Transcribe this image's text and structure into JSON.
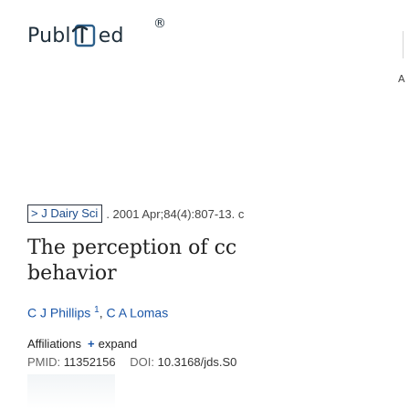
{
  "logo": {
    "text_left": "Publ",
    "text_right": "ed",
    "registered": "®",
    "mark_icon": "pubmed-mark-icon"
  },
  "edge": {
    "caret": "A"
  },
  "citation": {
    "journal": "> J Dairy Sci",
    "rest": ". 2001 Apr;84(4):807-13. c"
  },
  "article": {
    "title_line1": "The perception of cc",
    "title_line2": "behavior"
  },
  "authors": [
    {
      "name": "C J Phillips",
      "sup": "1"
    },
    {
      "name": "C A Lomas",
      "sup": ""
    }
  ],
  "authors_sep": ", ",
  "affiliations": {
    "label": "Affiliations",
    "expand_icon": "plus-icon",
    "expand_text": "expand"
  },
  "ids": {
    "pmid_label": "PMID:",
    "pmid": "11352156",
    "doi_label": "DOI:",
    "doi": "10.3168/jds.S0"
  },
  "colors": {
    "link": "#1a56a8",
    "brand_dark": "#20303c",
    "brand_accent": "#2c5f8a"
  }
}
